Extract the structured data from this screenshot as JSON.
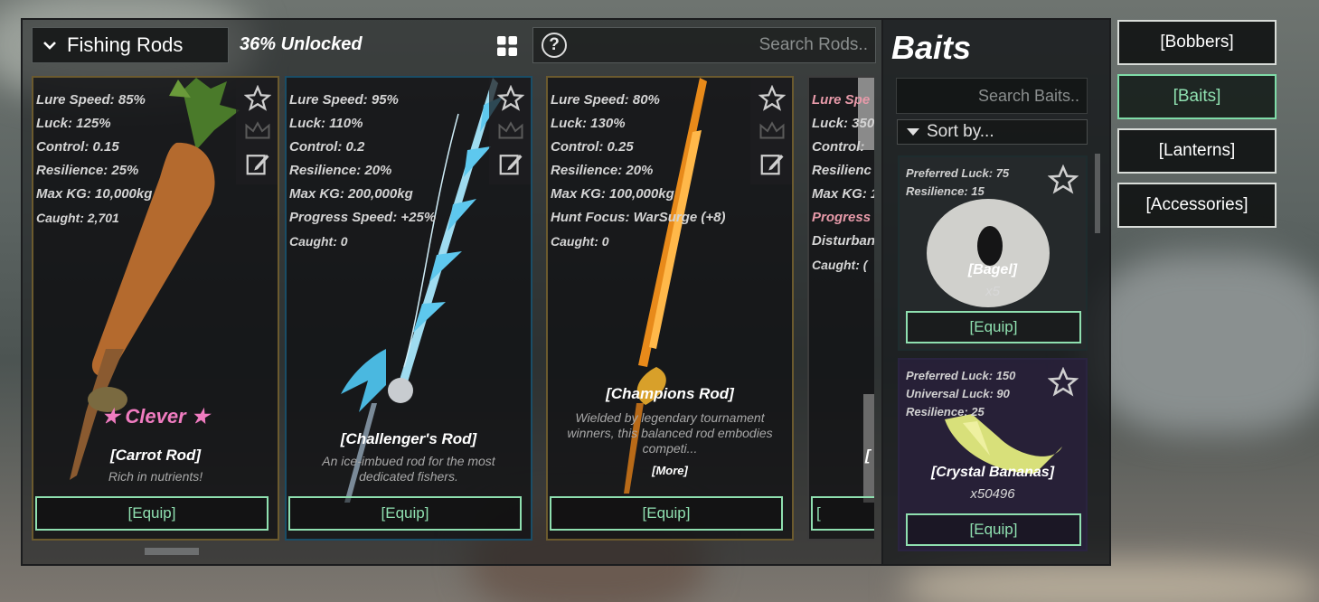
{
  "rods_panel": {
    "dropdown_label": "Fishing Rods",
    "unlocked_text": "36% Unlocked",
    "search_placeholder": "Search Rods..",
    "help_glyph": "?"
  },
  "cards": [
    {
      "stats": [
        "Lure Speed: 85%",
        "Luck: 125%",
        "Control: 0.15",
        "Resilience: 25%",
        "Max KG: 10,000kg"
      ],
      "caught": "Caught: 2,701",
      "badge": "★ Clever ★",
      "name": "[Carrot Rod]",
      "description": "Rich in nutrients!",
      "equip": "[Equip]"
    },
    {
      "stats": [
        "Lure Speed: 95%",
        "Luck: 110%",
        "Control: 0.2",
        "Resilience: 20%",
        "Max KG: 200,000kg",
        "Progress Speed: +25%"
      ],
      "caught": "Caught: 0",
      "name": "[Challenger's Rod]",
      "description": "An ice-imbued rod for the most dedicated fishers.",
      "equip": "[Equip]"
    },
    {
      "stats": [
        "Lure Speed: 80%",
        "Luck: 130%",
        "Control: 0.25",
        "Resilience: 20%",
        "Max KG: 100,000kg",
        "Hunt Focus: WarSurge (+8)"
      ],
      "caught": "Caught: 0",
      "name": "[Champions Rod]",
      "description": "Wielded by legendary tournament winners, this balanced rod embodies competi...",
      "more": "[More]",
      "equip": "[Equip]"
    },
    {
      "stats": [
        "Lure Spe",
        "Luck: 350",
        "Control:",
        "Resilienc",
        "Max KG: 1",
        "Progress",
        "Disturban"
      ],
      "caught": "Caught: (",
      "name": "[",
      "equip": "["
    }
  ],
  "bait_panel": {
    "title": "Baits",
    "search_placeholder": "Search Baits..",
    "sort_label": "Sort by..."
  },
  "baits": [
    {
      "stats": [
        "Preferred Luck: 75",
        "Resilience: 15"
      ],
      "name": "[Bagel]",
      "qty": "x5",
      "equip": "[Equip]"
    },
    {
      "stats": [
        "Preferred Luck: 150",
        "Universal Luck: 90",
        "Resilience: 25"
      ],
      "name": "[Crystal Bananas]",
      "qty": "x50496",
      "equip": "[Equip]"
    }
  ],
  "categories": [
    {
      "label": "[Bobbers]",
      "active": false
    },
    {
      "label": "[Baits]",
      "active": true
    },
    {
      "label": "[Lanterns]",
      "active": false
    },
    {
      "label": "[Accessories]",
      "active": false
    }
  ],
  "colors": {
    "equip_green": "#8fe0b0",
    "clever_pink": "#f07cc0",
    "active_tab": "#7fdca8"
  },
  "icons": [
    "chevron-down-icon",
    "grid-icon",
    "help-icon",
    "star-icon",
    "crown-icon",
    "edit-icon",
    "triangle-down-icon"
  ]
}
